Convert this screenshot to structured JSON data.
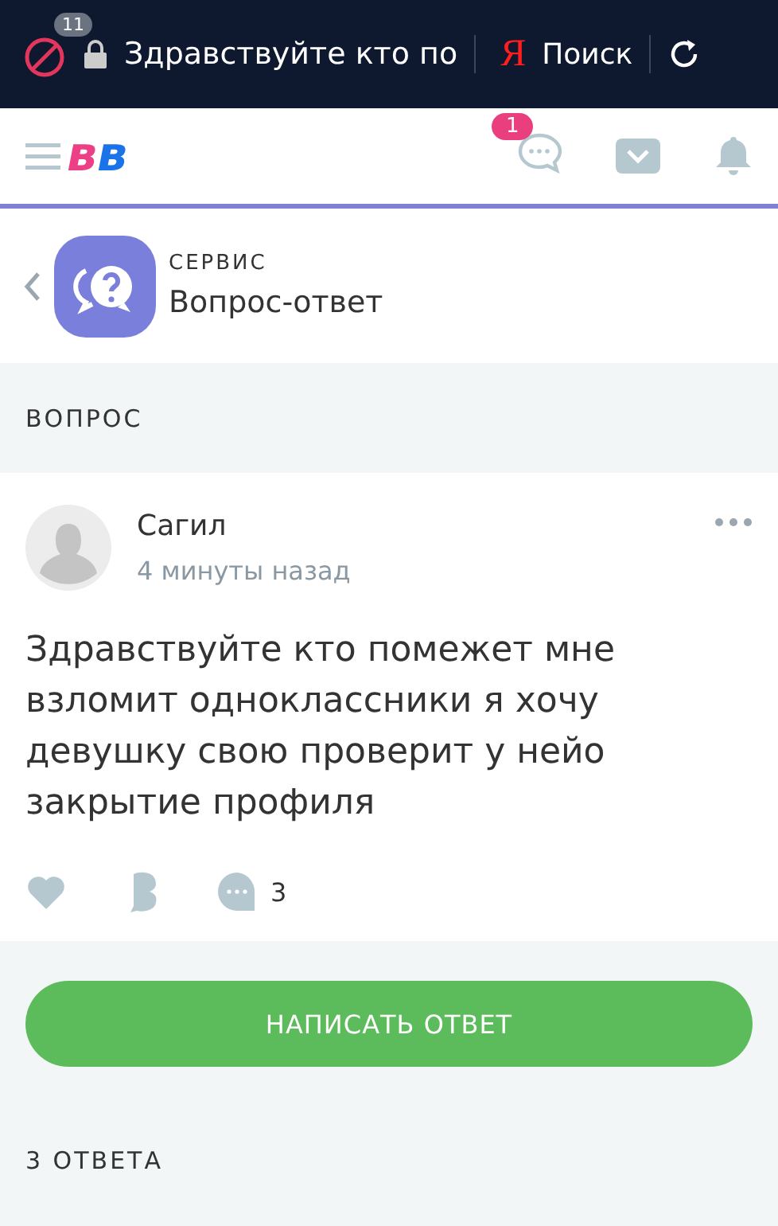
{
  "browser_bar": {
    "ad_count": "11",
    "address": "Здравствуйте кто по",
    "search_logo": "Я",
    "search_label": "Поиск"
  },
  "header": {
    "logo": [
      "в",
      "в"
    ],
    "messages_badge": "1"
  },
  "service": {
    "caption": "СЕРВИС",
    "title": "Вопрос-ответ"
  },
  "question_section": {
    "heading": "ВОПРОС"
  },
  "question": {
    "author": "Сагил",
    "time": "4 минуты назад",
    "text": "Здравствуйте кто помежет мне взломит одноклассники я хочу девушку свою проверит у нейо закрытие профиля",
    "comment_count": "3"
  },
  "answer_button": "НАПИСАТЬ ОТВЕТ",
  "answers_heading": "3 ОТВЕТА"
}
